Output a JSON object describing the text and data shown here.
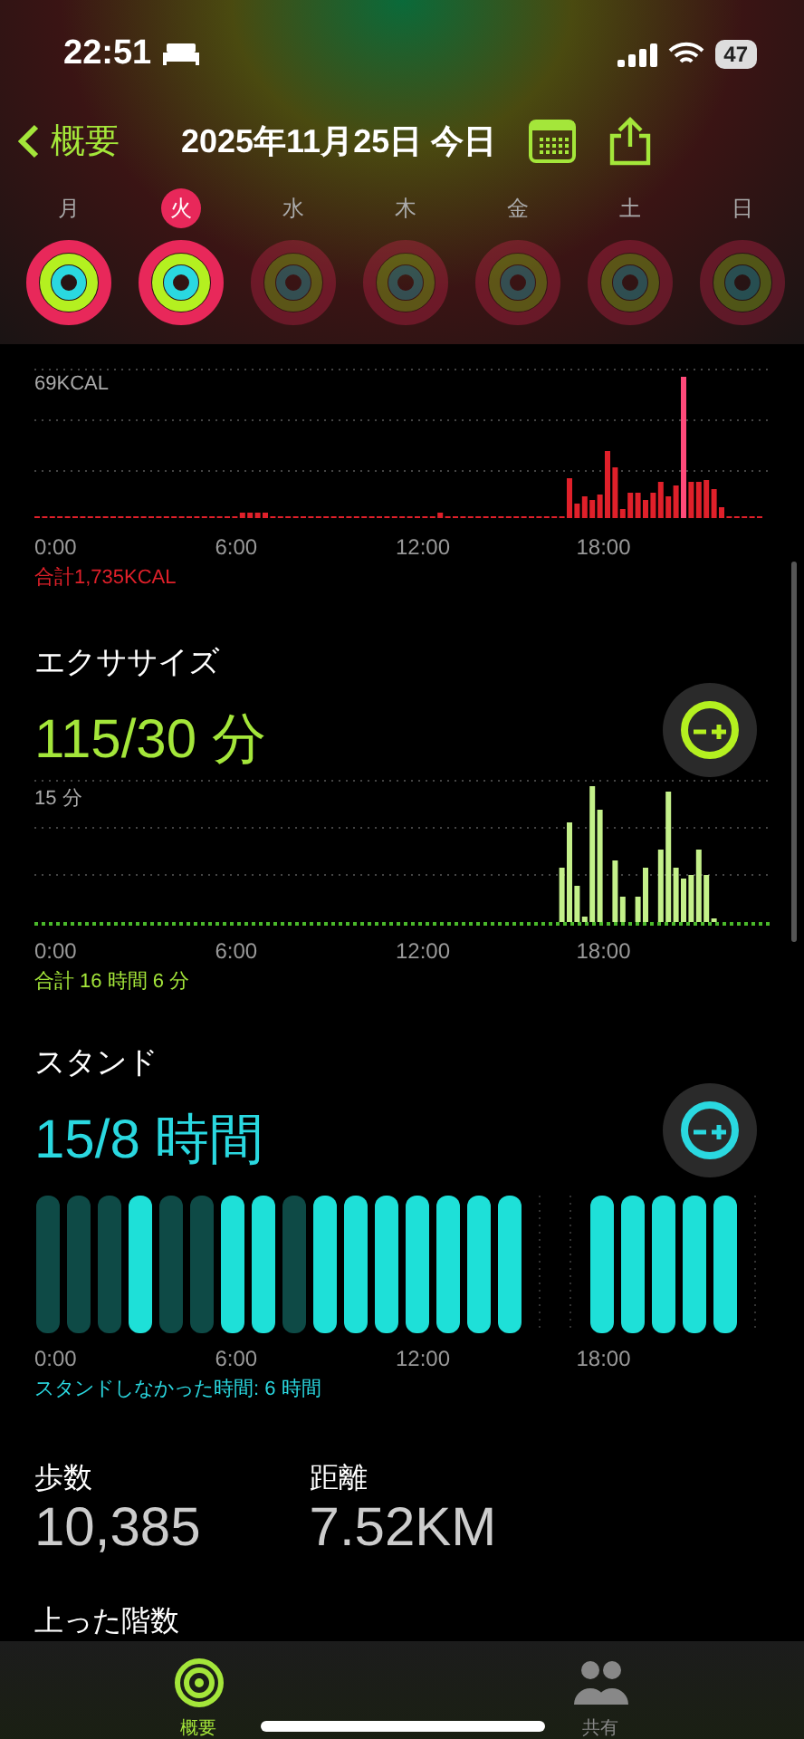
{
  "status_bar": {
    "time": "22:51",
    "battery": "47"
  },
  "nav": {
    "back": "概要",
    "title": "2025年11月25日 今日"
  },
  "week": [
    {
      "label": "月",
      "selected": false,
      "complete": true
    },
    {
      "label": "火",
      "selected": true,
      "complete": true
    },
    {
      "label": "水",
      "selected": false,
      "complete": false
    },
    {
      "label": "木",
      "selected": false,
      "complete": false
    },
    {
      "label": "金",
      "selected": false,
      "complete": false
    },
    {
      "label": "土",
      "selected": false,
      "complete": false
    },
    {
      "label": "日",
      "selected": false,
      "complete": false
    }
  ],
  "move": {
    "scale_label": "69KCAL",
    "x_labels": [
      "0:00",
      "6:00",
      "12:00",
      "18:00"
    ],
    "total": "合計1,735KCAL"
  },
  "exercise": {
    "title": "エクササイズ",
    "value": "115/30 分",
    "scale_label": "15 分",
    "x_labels": [
      "0:00",
      "6:00",
      "12:00",
      "18:00"
    ],
    "total": "合計 16 時間 6 分"
  },
  "stand": {
    "title": "スタンド",
    "value": "15/8 時間",
    "x_labels": [
      "0:00",
      "6:00",
      "12:00",
      "18:00"
    ],
    "total": "スタンドしなかった時間: 6 時間",
    "segments": [
      {
        "hours": [
          {
            "stood": false
          },
          {
            "stood": false
          },
          {
            "stood": false
          },
          {
            "stood": true
          },
          {
            "stood": false
          },
          {
            "stood": false
          },
          {
            "stood": true
          },
          {
            "stood": true
          },
          {
            "stood": false
          },
          {
            "stood": true
          },
          {
            "stood": true
          },
          {
            "stood": true
          },
          {
            "stood": true
          },
          {
            "stood": true
          },
          {
            "stood": true
          },
          {
            "stood": true
          }
        ]
      },
      {
        "hours": [
          {
            "stood": true
          },
          {
            "stood": true
          },
          {
            "stood": true
          },
          {
            "stood": true
          },
          {
            "stood": true
          }
        ]
      }
    ]
  },
  "stats": [
    {
      "label": "歩数",
      "value": "10,385"
    },
    {
      "label": "距離",
      "value": "7.52KM"
    }
  ],
  "next_section": "上った階数",
  "tab_bar": [
    {
      "label": "概要",
      "selected": true
    },
    {
      "label": "共有",
      "selected": false
    }
  ]
}
